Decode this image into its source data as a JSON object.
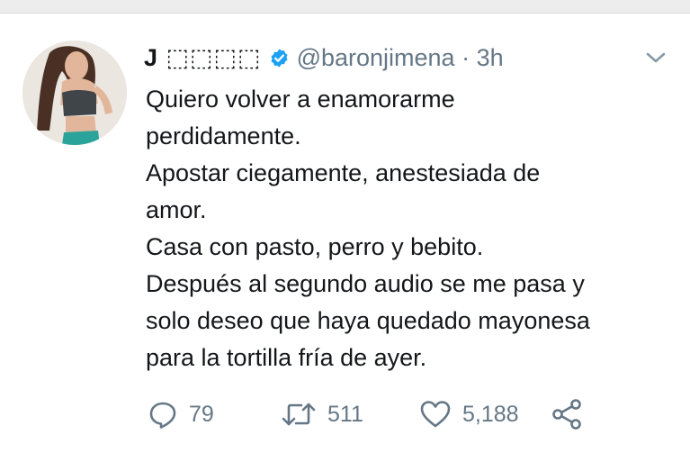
{
  "tweet": {
    "author_name": "J ⬚⬚⬚⬚",
    "handle": "@baronjimena",
    "separator": "·",
    "time": "3h",
    "text_lines": [
      "Quiero volver a enamorarme",
      "perdidamente.",
      "Apostar ciegamente, anestesiada de",
      "amor.",
      "Casa con pasto, perro y bebito.",
      "Después al segundo audio se me pasa y",
      "solo deseo que haya quedado mayonesa",
      "para la tortilla fría de ayer."
    ]
  },
  "actions": {
    "replies": "79",
    "retweets": "511",
    "likes": "5,188"
  },
  "icons": {
    "verified": "verified-badge-icon",
    "menu": "chevron-down-icon",
    "reply": "reply-icon",
    "retweet": "retweet-icon",
    "like": "heart-icon",
    "share": "share-icon"
  },
  "colors": {
    "verified_blue": "#1da1f2",
    "secondary_text": "#657786",
    "primary_text": "#14171a"
  }
}
